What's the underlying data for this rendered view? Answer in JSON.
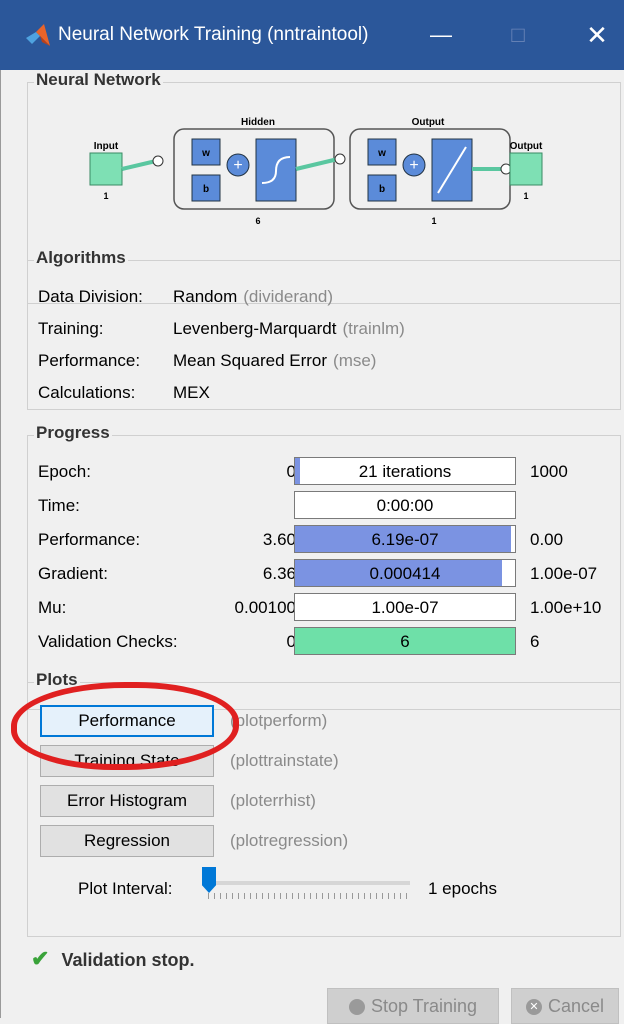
{
  "window": {
    "title": "Neural Network Training (nntraintool)",
    "controls": [
      "—",
      "□",
      "✕"
    ]
  },
  "neural_network": {
    "title": "Neural Network",
    "input": {
      "label": "Input",
      "size": "1"
    },
    "hidden": {
      "label": "Hidden",
      "w": "w",
      "b": "b",
      "size": "6"
    },
    "output_layer": {
      "label": "Output",
      "w": "w",
      "b": "b",
      "size": "1"
    },
    "output": {
      "label": "Output",
      "size": "1"
    }
  },
  "algorithms": {
    "title": "Algorithms",
    "rows": [
      {
        "label": "Data Division:",
        "value": "Random",
        "fn": "(dividerand)"
      },
      {
        "label": "Training:",
        "value": "Levenberg-Marquardt",
        "fn": "(trainlm)"
      },
      {
        "label": "Performance:",
        "value": "Mean Squared Error",
        "fn": "(mse)"
      },
      {
        "label": "Calculations:",
        "value": "MEX",
        "fn": ""
      }
    ]
  },
  "progress": {
    "title": "Progress",
    "rows": [
      {
        "label": "Epoch:",
        "start": "0",
        "value": "21 iterations",
        "end": "1000",
        "fill": 0.021,
        "fill_color": "#7b93e2"
      },
      {
        "label": "Time:",
        "start": "",
        "value": "0:00:00",
        "end": "",
        "fill": 0,
        "fill_color": "#7b93e2"
      },
      {
        "label": "Performance:",
        "start": "3.60",
        "value": "6.19e-07",
        "end": "0.00",
        "fill": 0.98,
        "fill_color": "#7b93e2"
      },
      {
        "label": "Gradient:",
        "start": "6.36",
        "value": "0.000414",
        "end": "1.00e-07",
        "fill": 0.94,
        "fill_color": "#7b93e2"
      },
      {
        "label": "Mu:",
        "start": "0.00100",
        "value": "1.00e-07",
        "end": "1.00e+10",
        "fill": 0,
        "fill_color": "#7b93e2"
      },
      {
        "label": "Validation Checks:",
        "start": "0",
        "value": "6",
        "end": "6",
        "fill": 1.0,
        "fill_color": "#6ee0a8"
      }
    ]
  },
  "plots": {
    "title": "Plots",
    "buttons": [
      {
        "label": "Performance",
        "fn": "(plotperform)"
      },
      {
        "label": "Training State",
        "fn": "(plottrainstate)"
      },
      {
        "label": "Error Histogram",
        "fn": "(ploterrhist)"
      },
      {
        "label": "Regression",
        "fn": "(plotregression)"
      }
    ],
    "interval_label": "Plot Interval:",
    "interval_value": "1 epochs",
    "interval_fraction": 0
  },
  "status": {
    "text": "Validation stop."
  },
  "footer": {
    "stop_label": "Stop Training",
    "cancel_label": "Cancel"
  },
  "colors": {
    "titlebar": "#2b579a",
    "progress_fill": "#7b93e2",
    "validation_fill": "#6ee0a8",
    "annotation": "#e02020"
  }
}
